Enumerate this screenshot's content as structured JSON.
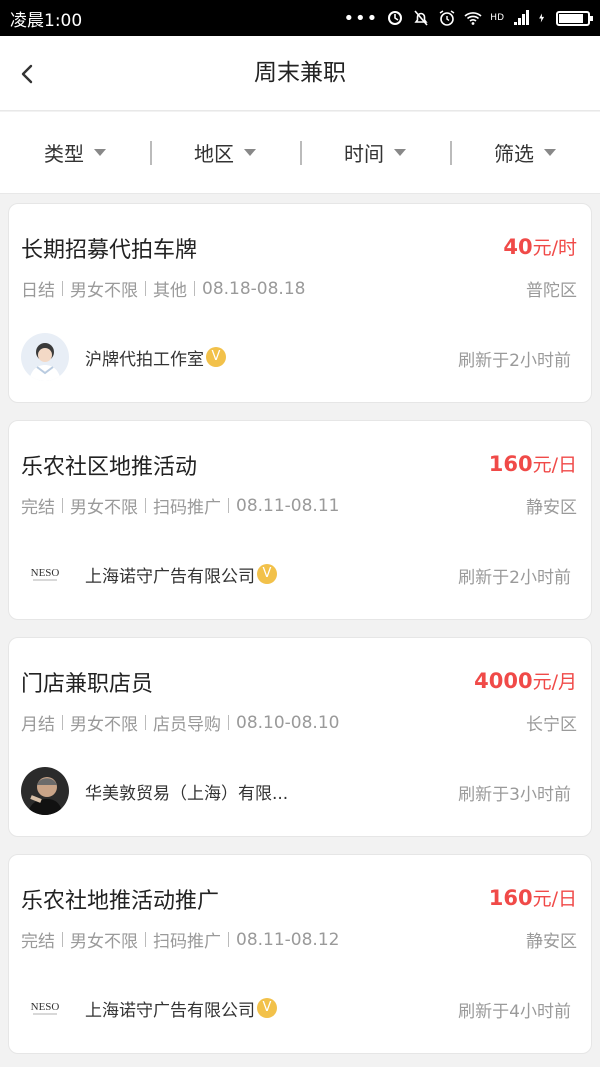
{
  "status_bar": {
    "time": "凌晨1:00",
    "network_badge": "HD",
    "battery_percent": 85
  },
  "nav": {
    "title": "周末兼职",
    "back_icon": "chevron-left-icon"
  },
  "filters": [
    {
      "label": "类型"
    },
    {
      "label": "地区"
    },
    {
      "label": "时间"
    },
    {
      "label": "筛选"
    }
  ],
  "jobs": [
    {
      "title": "长期招募代拍车牌",
      "pay_amount": "40",
      "pay_unit": "元/时",
      "tags": [
        "日结",
        "男女不限",
        "其他",
        "08.18-08.18"
      ],
      "district": "普陀区",
      "company": "沪牌代拍工作室",
      "verified_mark": "V",
      "refreshed": "刷新于2小时前"
    },
    {
      "title": "乐农社区地推活动",
      "pay_amount": "160",
      "pay_unit": "元/日",
      "tags": [
        "完结",
        "男女不限",
        "扫码推广",
        "08.11-08.11"
      ],
      "district": "静安区",
      "company": "上海诺守广告有限公司",
      "logo_text": "NESO",
      "verified_mark": "V",
      "refreshed": "刷新于2小时前"
    },
    {
      "title": "门店兼职店员",
      "pay_amount": "4000",
      "pay_unit": "元/月",
      "tags": [
        "月结",
        "男女不限",
        "店员导购",
        "08.10-08.10"
      ],
      "district": "长宁区",
      "company": "华美敦贸易（上海）有限...",
      "refreshed": "刷新于3小时前"
    },
    {
      "title": "乐农社地推活动推广",
      "pay_amount": "160",
      "pay_unit": "元/日",
      "tags": [
        "完结",
        "男女不限",
        "扫码推广",
        "08.11-08.12"
      ],
      "district": "静安区",
      "company": "上海诺守广告有限公司",
      "logo_text": "NESO",
      "verified_mark": "V",
      "refreshed": "刷新于4小时前"
    }
  ],
  "colors": {
    "accent": "#f04a48",
    "verified": "#f2c14a",
    "muted": "#9a9a9a"
  }
}
